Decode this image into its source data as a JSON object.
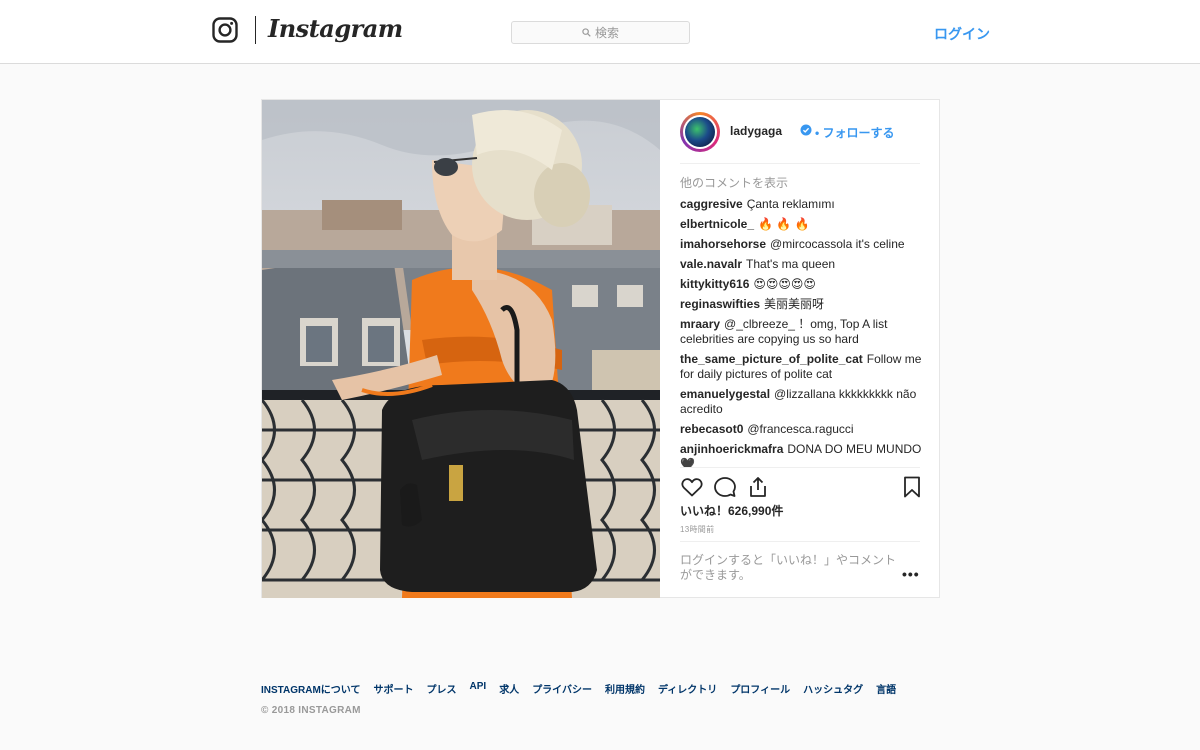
{
  "header": {
    "brand": "Instagram",
    "search_placeholder": "検索",
    "login_label": "ログイン"
  },
  "post": {
    "username": "ladygaga",
    "follow_label": "フォローする",
    "view_more_comments": "他のコメントを表示",
    "comments": [
      {
        "user": "caggresive",
        "text": "Çanta reklamımı"
      },
      {
        "user": "elbertnicole_",
        "text": "🔥 🔥 🔥"
      },
      {
        "user": "imahorsehorse",
        "text": "@mircocassola it's celine"
      },
      {
        "user": "vale.navalr",
        "text": "That's ma queen"
      },
      {
        "user": "kittykitty616",
        "text": "😍😍😍😍😍"
      },
      {
        "user": "reginaswifties",
        "text": "美丽美丽呀"
      },
      {
        "user": "mraary",
        "text": "@_clbreeze_ ！omg,   Top A list celebrities are copying us so hard"
      },
      {
        "user": "the_same_picture_of_polite_cat",
        "text": "Follow me for daily pictures of polite cat"
      },
      {
        "user": "emanuelygestal",
        "text": "@lizzallana kkkkkkkkk não acredito"
      },
      {
        "user": "rebecasot0",
        "text": "@francesca.ragucci"
      },
      {
        "user": "anjinhoerickmafra",
        "text": "DONA DO MEU MUNDO 🖤"
      }
    ],
    "likes": "いいね！626,990件",
    "timestamp": "13時間前",
    "login_prompt": "ログインすると「いいね！」やコメントができます。",
    "more_options": "•••"
  },
  "footer": {
    "links": [
      "INSTAGRAMについて",
      "サポート",
      "プレス",
      "API",
      "求人",
      "プライバシー",
      "利用規約",
      "ディレクトリ",
      "プロフィール",
      "ハッシュタグ",
      "言語"
    ],
    "copyright": "© 2018 INSTAGRAM"
  },
  "colors": {
    "accent": "#3897f0",
    "footer_link": "#003569",
    "muted": "#999999",
    "border": "#dbdbdb"
  }
}
